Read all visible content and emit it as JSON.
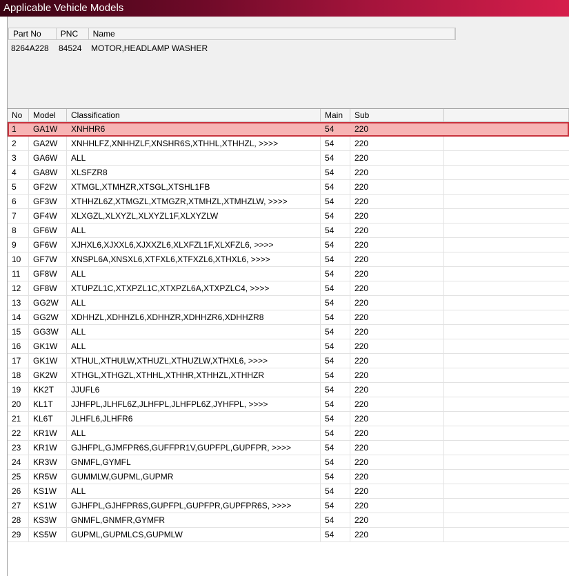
{
  "window": {
    "title": "Applicable Vehicle Models"
  },
  "part_table": {
    "columns": [
      "Part No",
      "PNC",
      "Name"
    ],
    "rows": [
      {
        "part_no": "8264A228",
        "pnc": "84524",
        "name": "MOTOR,HEADLAMP WASHER"
      }
    ]
  },
  "models_table": {
    "columns": [
      "No",
      "Model",
      "Classification",
      "Main",
      "Sub"
    ],
    "selected_row": 1,
    "rows": [
      {
        "no": "1",
        "model": "GA1W",
        "classification": "XNHHR6",
        "main": "54",
        "sub": "220"
      },
      {
        "no": "2",
        "model": "GA2W",
        "classification": "XNHHLFZ,XNHHZLF,XNSHR6S,XTHHL,XTHHZL,  >>>>",
        "main": "54",
        "sub": "220"
      },
      {
        "no": "3",
        "model": "GA6W",
        "classification": "ALL",
        "main": "54",
        "sub": "220"
      },
      {
        "no": "4",
        "model": "GA8W",
        "classification": "XLSFZR8",
        "main": "54",
        "sub": "220"
      },
      {
        "no": "5",
        "model": "GF2W",
        "classification": "XTMGL,XTMHZR,XTSGL,XTSHL1FB",
        "main": "54",
        "sub": "220"
      },
      {
        "no": "6",
        "model": "GF3W",
        "classification": "XTHHZL6Z,XTMGZL,XTMGZR,XTMHZL,XTMHZLW,  >>>>",
        "main": "54",
        "sub": "220"
      },
      {
        "no": "7",
        "model": "GF4W",
        "classification": "XLXGZL,XLXYZL,XLXYZL1F,XLXYZLW",
        "main": "54",
        "sub": "220"
      },
      {
        "no": "8",
        "model": "GF6W",
        "classification": "ALL",
        "main": "54",
        "sub": "220"
      },
      {
        "no": "9",
        "model": "GF6W",
        "classification": "XJHXL6,XJXXL6,XJXXZL6,XLXFZL1F,XLXFZL6,  >>>>",
        "main": "54",
        "sub": "220"
      },
      {
        "no": "10",
        "model": "GF7W",
        "classification": "XNSPL6A,XNSXL6,XTFXL6,XTFXZL6,XTHXL6,  >>>>",
        "main": "54",
        "sub": "220"
      },
      {
        "no": "11",
        "model": "GF8W",
        "classification": "ALL",
        "main": "54",
        "sub": "220"
      },
      {
        "no": "12",
        "model": "GF8W",
        "classification": "XTUPZL1C,XTXPZL1C,XTXPZL6A,XTXPZLC4,  >>>>",
        "main": "54",
        "sub": "220"
      },
      {
        "no": "13",
        "model": "GG2W",
        "classification": "ALL",
        "main": "54",
        "sub": "220"
      },
      {
        "no": "14",
        "model": "GG2W",
        "classification": "XDHHZL,XDHHZL6,XDHHZR,XDHHZR6,XDHHZR8",
        "main": "54",
        "sub": "220"
      },
      {
        "no": "15",
        "model": "GG3W",
        "classification": "ALL",
        "main": "54",
        "sub": "220"
      },
      {
        "no": "16",
        "model": "GK1W",
        "classification": "ALL",
        "main": "54",
        "sub": "220"
      },
      {
        "no": "17",
        "model": "GK1W",
        "classification": "XTHUL,XTHULW,XTHUZL,XTHUZLW,XTHXL6,  >>>>",
        "main": "54",
        "sub": "220"
      },
      {
        "no": "18",
        "model": "GK2W",
        "classification": "XTHGL,XTHGZL,XTHHL,XTHHR,XTHHZL,XTHHZR",
        "main": "54",
        "sub": "220"
      },
      {
        "no": "19",
        "model": "KK2T",
        "classification": "JJUFL6",
        "main": "54",
        "sub": "220"
      },
      {
        "no": "20",
        "model": "KL1T",
        "classification": "JJHFPL,JLHFL6Z,JLHFPL,JLHFPL6Z,JYHFPL,  >>>>",
        "main": "54",
        "sub": "220"
      },
      {
        "no": "21",
        "model": "KL6T",
        "classification": "JLHFL6,JLHFR6",
        "main": "54",
        "sub": "220"
      },
      {
        "no": "22",
        "model": "KR1W",
        "classification": "ALL",
        "main": "54",
        "sub": "220"
      },
      {
        "no": "23",
        "model": "KR1W",
        "classification": "GJHFPL,GJMFPR6S,GUFFPR1V,GUPFPL,GUPFPR,  >>>>",
        "main": "54",
        "sub": "220"
      },
      {
        "no": "24",
        "model": "KR3W",
        "classification": "GNMFL,GYMFL",
        "main": "54",
        "sub": "220"
      },
      {
        "no": "25",
        "model": "KR5W",
        "classification": "GUMMLW,GUPML,GUPMR",
        "main": "54",
        "sub": "220"
      },
      {
        "no": "26",
        "model": "KS1W",
        "classification": "ALL",
        "main": "54",
        "sub": "220"
      },
      {
        "no": "27",
        "model": "KS1W",
        "classification": "GJHFPL,GJHFPR6S,GUPFPL,GUPFPR,GUPFPR6S,  >>>>",
        "main": "54",
        "sub": "220"
      },
      {
        "no": "28",
        "model": "KS3W",
        "classification": "GNMFL,GNMFR,GYMFR",
        "main": "54",
        "sub": "220"
      },
      {
        "no": "29",
        "model": "KS5W",
        "classification": "GUPML,GUPMLCS,GUPMLW",
        "main": "54",
        "sub": "220"
      }
    ]
  },
  "colors": {
    "titlebar_start": "#3a0414",
    "titlebar_end": "#d61e4b",
    "selection_fill": "#f7b4b4",
    "selection_border": "#c8323c"
  }
}
